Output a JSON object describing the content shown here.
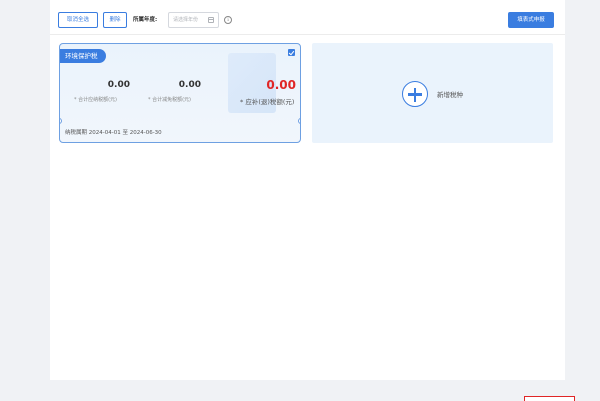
{
  "toolbar": {
    "cancel_all_label": "取消全选",
    "delete_label": "删除",
    "year_label": "所属年度:",
    "year_placeholder": "请选择年份",
    "submit_label": "填表式申报"
  },
  "tax_card": {
    "name": "环境保护税",
    "checked": true,
    "amounts": [
      {
        "value": "0.00",
        "label": "合计应纳税额(元)"
      },
      {
        "value": "0.00",
        "label": "合计减免税额(元)"
      },
      {
        "value": "0.00",
        "label": "应补(退)税额(元)"
      }
    ],
    "period": "纳税属期 2024-04-01 至 2024-06-30"
  },
  "add_card": {
    "label": "新增税种"
  },
  "colors": {
    "primary": "#3a7de0",
    "card_bg": "#eaf3fc",
    "due_amount": "#e02626"
  }
}
